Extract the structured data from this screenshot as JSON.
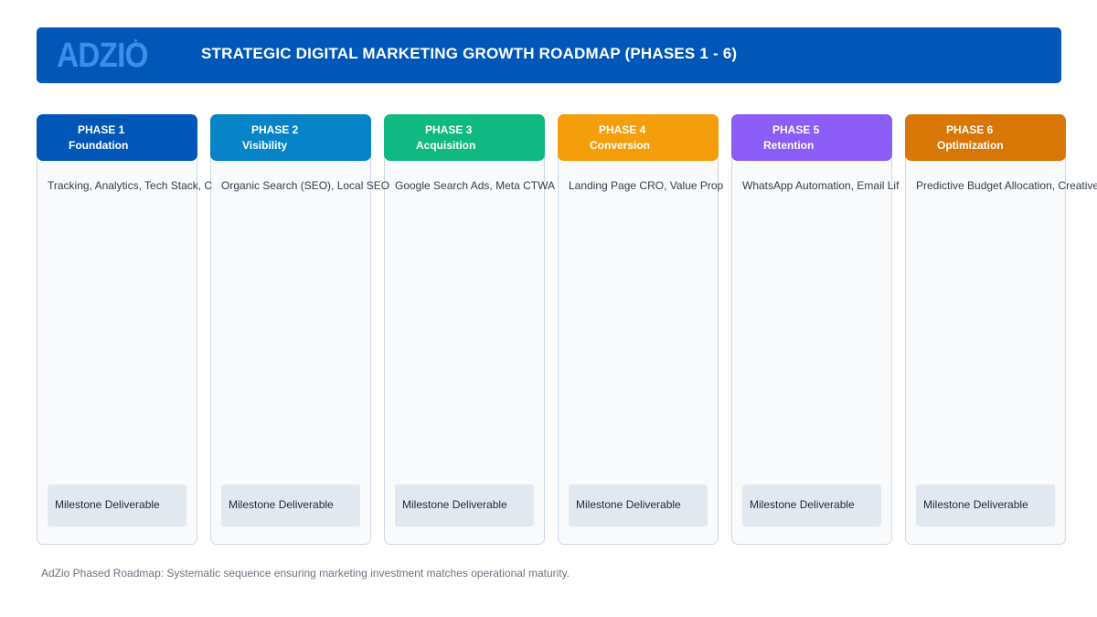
{
  "header": {
    "logo_text": "ADZIO",
    "title": "STRATEGIC DIGITAL MARKETING GROWTH ROADMAP (PHASES 1 - 6)",
    "background_color": "#0057b8",
    "logo_color": "#3b8fe8"
  },
  "phases": [
    {
      "number_label": "PHASE 1",
      "name": "Foundation",
      "focus": "Tracking, Analytics, Tech Stack, C",
      "milestone": "Milestone Deliverable",
      "color": "#0057b8"
    },
    {
      "number_label": "PHASE 2",
      "name": "Visibility",
      "focus": "Organic Search (SEO), Local SEO",
      "milestone": "Milestone Deliverable",
      "color": "#0784c7"
    },
    {
      "number_label": "PHASE 3",
      "name": "Acquisition",
      "focus": "Google Search Ads, Meta CTWA",
      "milestone": "Milestone Deliverable",
      "color": "#10b981"
    },
    {
      "number_label": "PHASE 4",
      "name": "Conversion",
      "focus": "Landing Page CRO, Value Prop",
      "milestone": "Milestone Deliverable",
      "color": "#f59e0b"
    },
    {
      "number_label": "PHASE 5",
      "name": "Retention",
      "focus": "WhatsApp Automation, Email Lif",
      "milestone": "Milestone Deliverable",
      "color": "#8b5cf6"
    },
    {
      "number_label": "PHASE 6",
      "name": "Optimization",
      "focus": "Predictive Budget Allocation, Creative",
      "milestone": "Milestone Deliverable",
      "color": "#d97706"
    }
  ],
  "caption": "AdZio Phased Roadmap: Systematic sequence ensuring marketing investment matches operational maturity."
}
